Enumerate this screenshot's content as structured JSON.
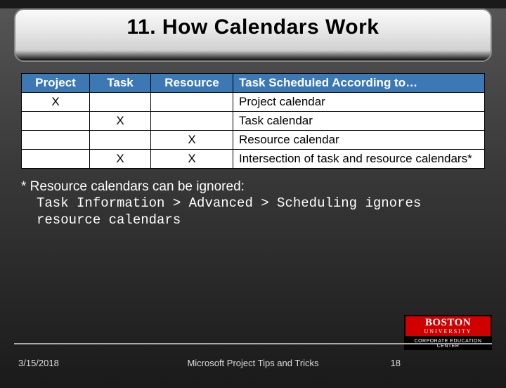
{
  "title": "11. How Calendars Work",
  "table": {
    "headers": [
      "Project",
      "Task",
      "Resource",
      "Task Scheduled According to…"
    ],
    "rows": [
      {
        "project": "X",
        "task": "",
        "resource": "",
        "desc": "Project calendar"
      },
      {
        "project": "",
        "task": "X",
        "resource": "",
        "desc": "Task calendar"
      },
      {
        "project": "",
        "task": "",
        "resource": "X",
        "desc": "Resource calendar"
      },
      {
        "project": "",
        "task": "X",
        "resource": "X",
        "desc": "Intersection of task and resource calendars*"
      }
    ]
  },
  "note": {
    "lead": "* Resource calendars can be ignored:",
    "path1": "Task Information > Advanced > Scheduling ignores",
    "path2": "resource calendars"
  },
  "footer": {
    "date": "3/15/2018",
    "center": "Microsoft Project Tips and Tricks",
    "page": "18"
  },
  "logo": {
    "line1": "BOSTON",
    "line2": "UNIVERSITY",
    "line3": "CORPORATE EDUCATION CENTER"
  }
}
